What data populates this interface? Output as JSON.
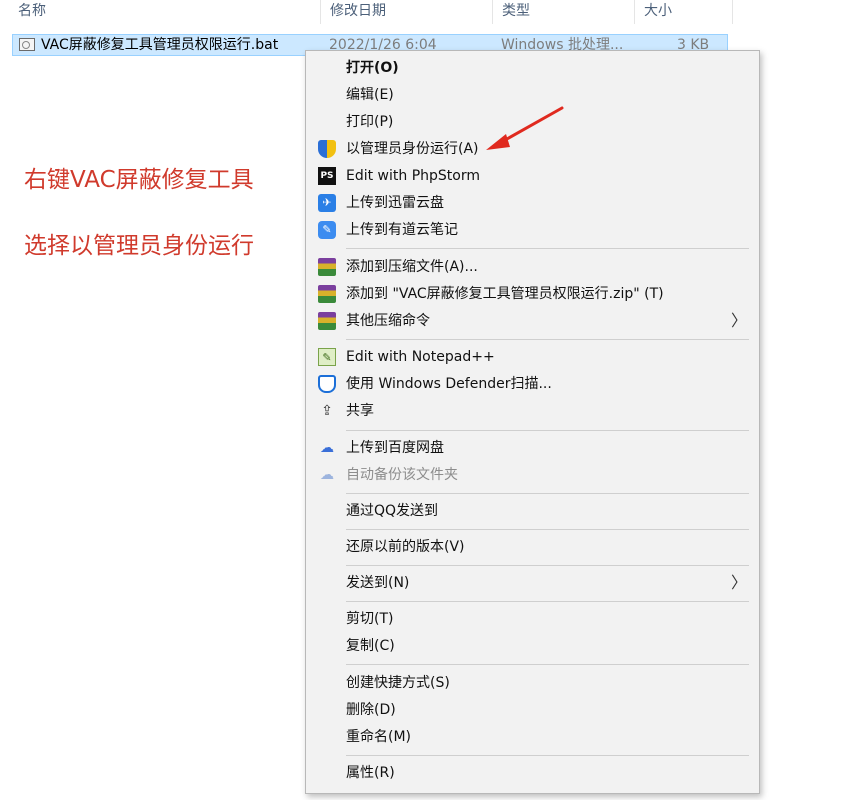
{
  "explorer": {
    "columns": [
      "名称",
      "修改日期",
      "类型",
      "大小"
    ],
    "file": {
      "name": "VAC屏蔽修复工具管理员权限运行.bat",
      "date": "2022/1/26 6:04",
      "type": "Windows 批处理...",
      "size": "3 KB"
    }
  },
  "annotation": {
    "line1": "右键VAC屏蔽修复工具",
    "line2": "选择以管理员身份运行",
    "color": "#d03a2c"
  },
  "menu": {
    "items": [
      {
        "label": "打开(O)"
      },
      {
        "label": "编辑(E)"
      },
      {
        "label": "打印(P)"
      },
      {
        "label": "以管理员身份运行(A)",
        "icon": "uac-shield-icon"
      },
      {
        "label": "Edit with PhpStorm",
        "icon": "phpstorm-icon",
        "icon_text": "PS"
      },
      {
        "label": "上传到迅雷云盘",
        "icon": "xunlei-icon",
        "icon_text": "✈"
      },
      {
        "label": "上传到有道云笔记",
        "icon": "youdao-note-icon",
        "icon_text": "✎"
      },
      {
        "label": "添加到压缩文件(A)...",
        "icon": "winrar-icon"
      },
      {
        "label": "添加到 \"VAC屏蔽修复工具管理员权限运行.zip\" (T)",
        "icon": "winrar-icon"
      },
      {
        "label": "其他压缩命令",
        "icon": "winrar-icon",
        "submenu_glyph": "〉"
      },
      {
        "label": "Edit with Notepad++",
        "icon": "notepadpp-icon",
        "icon_text": "✎"
      },
      {
        "label": "使用 Windows Defender扫描...",
        "icon": "defender-icon"
      },
      {
        "label": "共享",
        "icon": "share-icon",
        "icon_text": "⇪"
      },
      {
        "label": "上传到百度网盘",
        "icon": "baidu-netdisk-icon",
        "icon_text": "☁"
      },
      {
        "label": "自动备份该文件夹",
        "icon": "baidu-backup-icon",
        "icon_text": "☁"
      },
      {
        "label": "通过QQ发送到"
      },
      {
        "label": "还原以前的版本(V)"
      },
      {
        "label": "发送到(N)",
        "submenu_glyph": "〉"
      },
      {
        "label": "剪切(T)"
      },
      {
        "label": "复制(C)"
      },
      {
        "label": "创建快捷方式(S)"
      },
      {
        "label": "删除(D)"
      },
      {
        "label": "重命名(M)"
      },
      {
        "label": "属性(R)"
      }
    ]
  }
}
